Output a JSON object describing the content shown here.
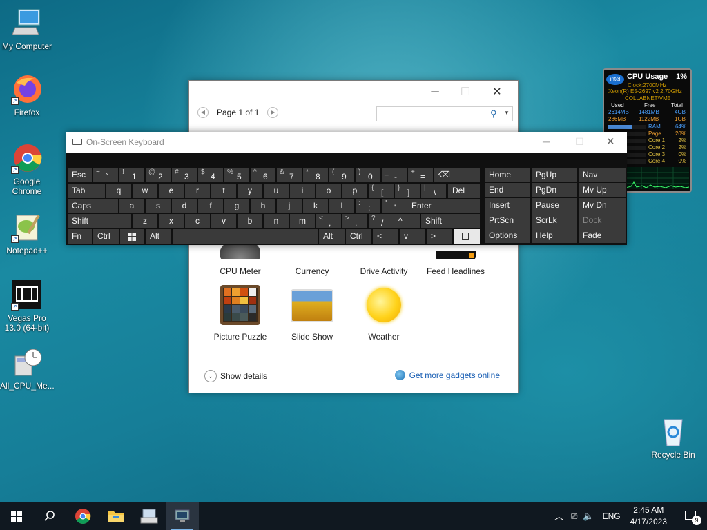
{
  "desktop": {
    "icons": [
      {
        "label": "My Computer",
        "icon": "computer-icon"
      },
      {
        "label": "Firefox",
        "icon": "firefox-icon"
      },
      {
        "label": "Google Chrome",
        "icon": "chrome-icon"
      },
      {
        "label": "Notepad++",
        "icon": "notepadpp-icon"
      },
      {
        "label": "Vegas Pro 13.0 (64-bit)",
        "icon": "vegas-icon"
      },
      {
        "label": "All_CPU_Me...",
        "icon": "cpu-meter-app-icon"
      },
      {
        "label": "Recycle Bin",
        "icon": "recycle-bin-icon"
      }
    ]
  },
  "gallery": {
    "page_label": "Page 1 of 1",
    "search_placeholder": "",
    "gadgets": [
      {
        "label": "CPU Meter"
      },
      {
        "label": "Currency"
      },
      {
        "label": "Drive Activity"
      },
      {
        "label": "Feed Headlines"
      },
      {
        "label": "Picture Puzzle"
      },
      {
        "label": "Slide Show"
      },
      {
        "label": "Weather"
      }
    ],
    "show_details": "Show details",
    "get_more": "Get more gadgets online"
  },
  "osk": {
    "title": "On-Screen Keyboard",
    "row1": {
      "esc": "Esc",
      "keys": [
        [
          "~",
          "`"
        ],
        [
          "!",
          "1"
        ],
        [
          "@",
          "2"
        ],
        [
          "#",
          "3"
        ],
        [
          "$",
          "4"
        ],
        [
          "%",
          "5"
        ],
        [
          "^",
          "6"
        ],
        [
          "&",
          "7"
        ],
        [
          "*",
          "8"
        ],
        [
          "(",
          "9"
        ],
        [
          ")",
          "0"
        ],
        [
          "_",
          "-"
        ],
        [
          "+",
          "="
        ]
      ],
      "backspace": "⌫"
    },
    "row2": {
      "tab": "Tab",
      "letters": [
        "q",
        "w",
        "e",
        "r",
        "t",
        "y",
        "u",
        "i",
        "o",
        "p"
      ],
      "extra": [
        [
          "{",
          "["
        ],
        [
          "}",
          "]"
        ],
        [
          "|",
          "\\"
        ]
      ],
      "del": "Del"
    },
    "row3": {
      "caps": "Caps",
      "letters": [
        "a",
        "s",
        "d",
        "f",
        "g",
        "h",
        "j",
        "k",
        "l"
      ],
      "extra": [
        [
          ":",
          ";"
        ],
        [
          "\"",
          "'"
        ]
      ],
      "enter": "Enter"
    },
    "row4": {
      "shift": "Shift",
      "letters": [
        "z",
        "x",
        "c",
        "v",
        "b",
        "n",
        "m"
      ],
      "extra": [
        [
          "<",
          ","
        ],
        [
          ">",
          "."
        ],
        [
          "?",
          "/"
        ]
      ],
      "up": "^",
      "shift2": "Shift"
    },
    "row5": {
      "fn": "Fn",
      "ctrl": "Ctrl",
      "alt": "Alt",
      "alt2": "Alt",
      "ctrl2": "Ctrl",
      "left": "<",
      "down": "v",
      "right": ">"
    },
    "nav": [
      [
        "Home",
        "PgUp",
        "Nav"
      ],
      [
        "End",
        "PgDn",
        "Mv Up"
      ],
      [
        "Insert",
        "Pause",
        "Mv Dn"
      ],
      [
        "PrtScn",
        "ScrLk",
        "Dock"
      ],
      [
        "Options",
        "Help",
        "Fade"
      ]
    ]
  },
  "cpu_gadget": {
    "title": "CPU Usage",
    "percent": "1%",
    "brand": "intel",
    "clock": "Clock:2700MHz",
    "model": "Xeon(R) E5-2697 v2 2.70GHz",
    "host": "COLLABNET\\VM5",
    "headers": [
      "Used",
      "Free",
      "Total"
    ],
    "mem_rows": [
      [
        "2614MB",
        "1481MB",
        "4GB"
      ],
      [
        "286MB",
        "1122MB",
        "1GB"
      ]
    ],
    "stats": [
      {
        "label": "RAM",
        "value": "64%",
        "fill": 0.64
      },
      {
        "label": "Page",
        "value": "20%",
        "fill": 0.2
      },
      {
        "label": "Core 1",
        "value": "2%",
        "fill": 0.02
      },
      {
        "label": "Core 2",
        "value": "2%",
        "fill": 0.02
      },
      {
        "label": "Core 3",
        "value": "0%",
        "fill": 0
      },
      {
        "label": "Core 4",
        "value": "0%",
        "fill": 0
      }
    ]
  },
  "taskbar": {
    "lang": "ENG",
    "time": "2:45 AM",
    "date": "4/17/2023",
    "notifications": "9"
  }
}
